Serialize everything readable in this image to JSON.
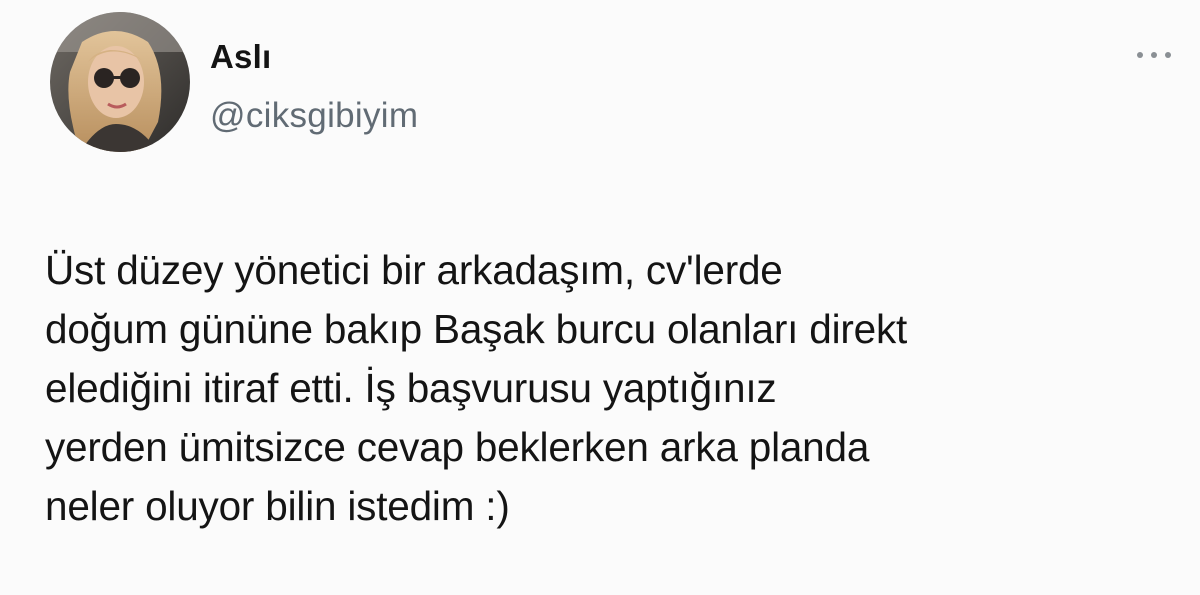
{
  "tweet": {
    "author": {
      "display_name": "Aslı",
      "handle": "@ciksgibiyim",
      "avatar_icon": "profile-photo"
    },
    "more_icon": "more-horizontal-icon",
    "text": "Üst düzey yönetici bir arkadaşım, cv'lerde\ndoğum gününe bakıp Başak burcu olanları direkt\nelediğini itiraf etti.   İş başvurusu yaptığınız\nyerden ümitsizce cevap beklerken arka planda\nneler oluyor bilin istedim :)"
  },
  "colors": {
    "background": "#fbfbfb",
    "text": "#141414",
    "secondary_text": "#616b74",
    "icon_gray": "#8a8f94"
  }
}
